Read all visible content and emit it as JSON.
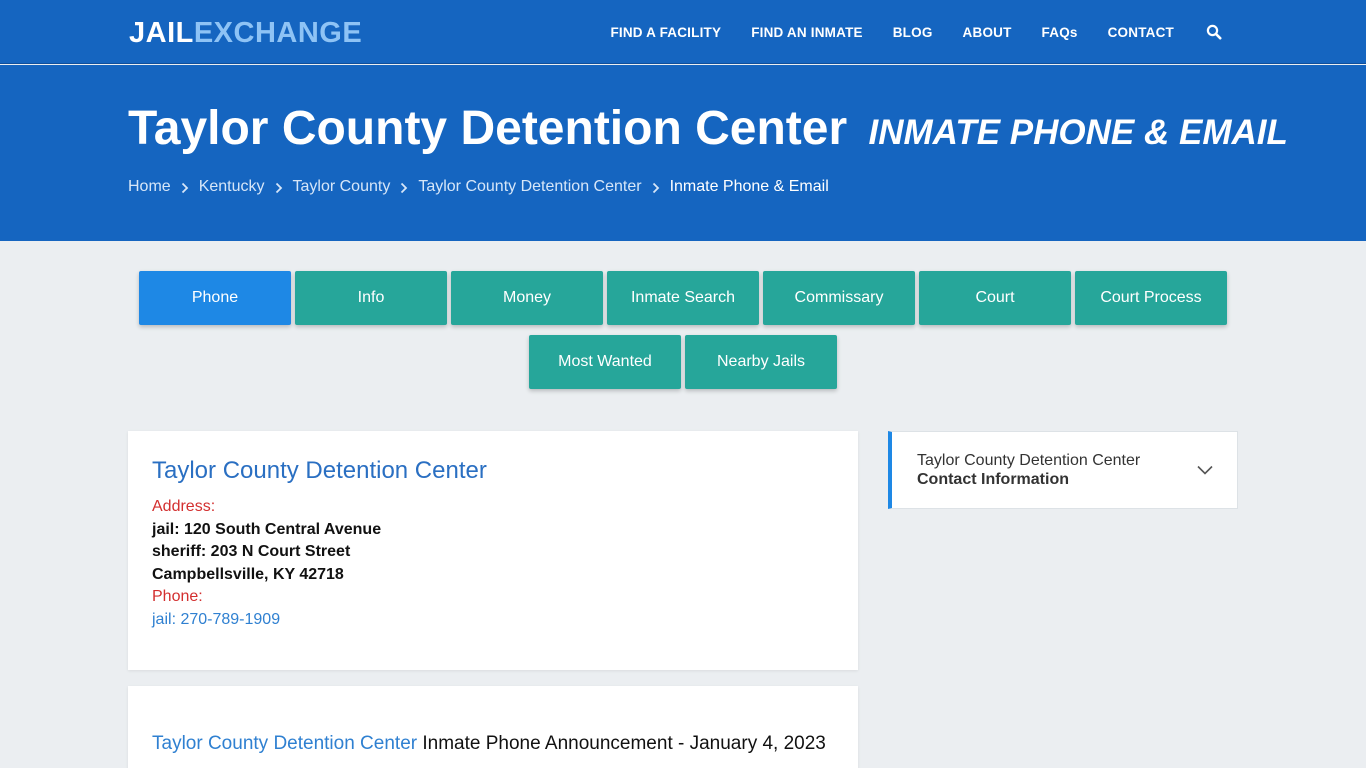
{
  "header": {
    "logo_part1": "JAIL",
    "logo_part2": "EXCHANGE",
    "nav": [
      "FIND A FACILITY",
      "FIND AN INMATE",
      "BLOG",
      "ABOUT",
      "FAQs",
      "CONTACT"
    ],
    "search_icon": "search-icon"
  },
  "hero": {
    "title": "Taylor County Detention Center",
    "subtitle": "INMATE PHONE & EMAIL",
    "breadcrumbs": [
      "Home",
      "Kentucky",
      "Taylor County",
      "Taylor County Detention Center"
    ],
    "breadcrumb_current": "Inmate Phone & Email"
  },
  "tabs": {
    "row1": [
      "Phone",
      "Info",
      "Money",
      "Inmate Search",
      "Commissary",
      "Court",
      "Court Process"
    ],
    "row2": [
      "Most Wanted",
      "Nearby Jails"
    ],
    "active": "Phone"
  },
  "facility_card": {
    "title": "Taylor County Detention Center",
    "address_label": "Address:",
    "address_lines": [
      "jail: 120 South Central Avenue",
      "sheriff: 203 N Court Street",
      "Campbellsville, KY 42718"
    ],
    "phone_label": "Phone:",
    "phone_value": "jail: 270-789-1909"
  },
  "announcement": {
    "link_text": "Taylor County Detention Center",
    "text": " Inmate Phone Announcement - January 4, 2023"
  },
  "sidebar": {
    "line1": "Taylor County Detention Center",
    "line2": "Contact Information"
  },
  "colors": {
    "header_blue": "#1565c0",
    "tab_teal": "#26a69a",
    "tab_active_blue": "#1e88e5",
    "label_red": "#d32f2f",
    "link_blue": "#2f80d1"
  }
}
